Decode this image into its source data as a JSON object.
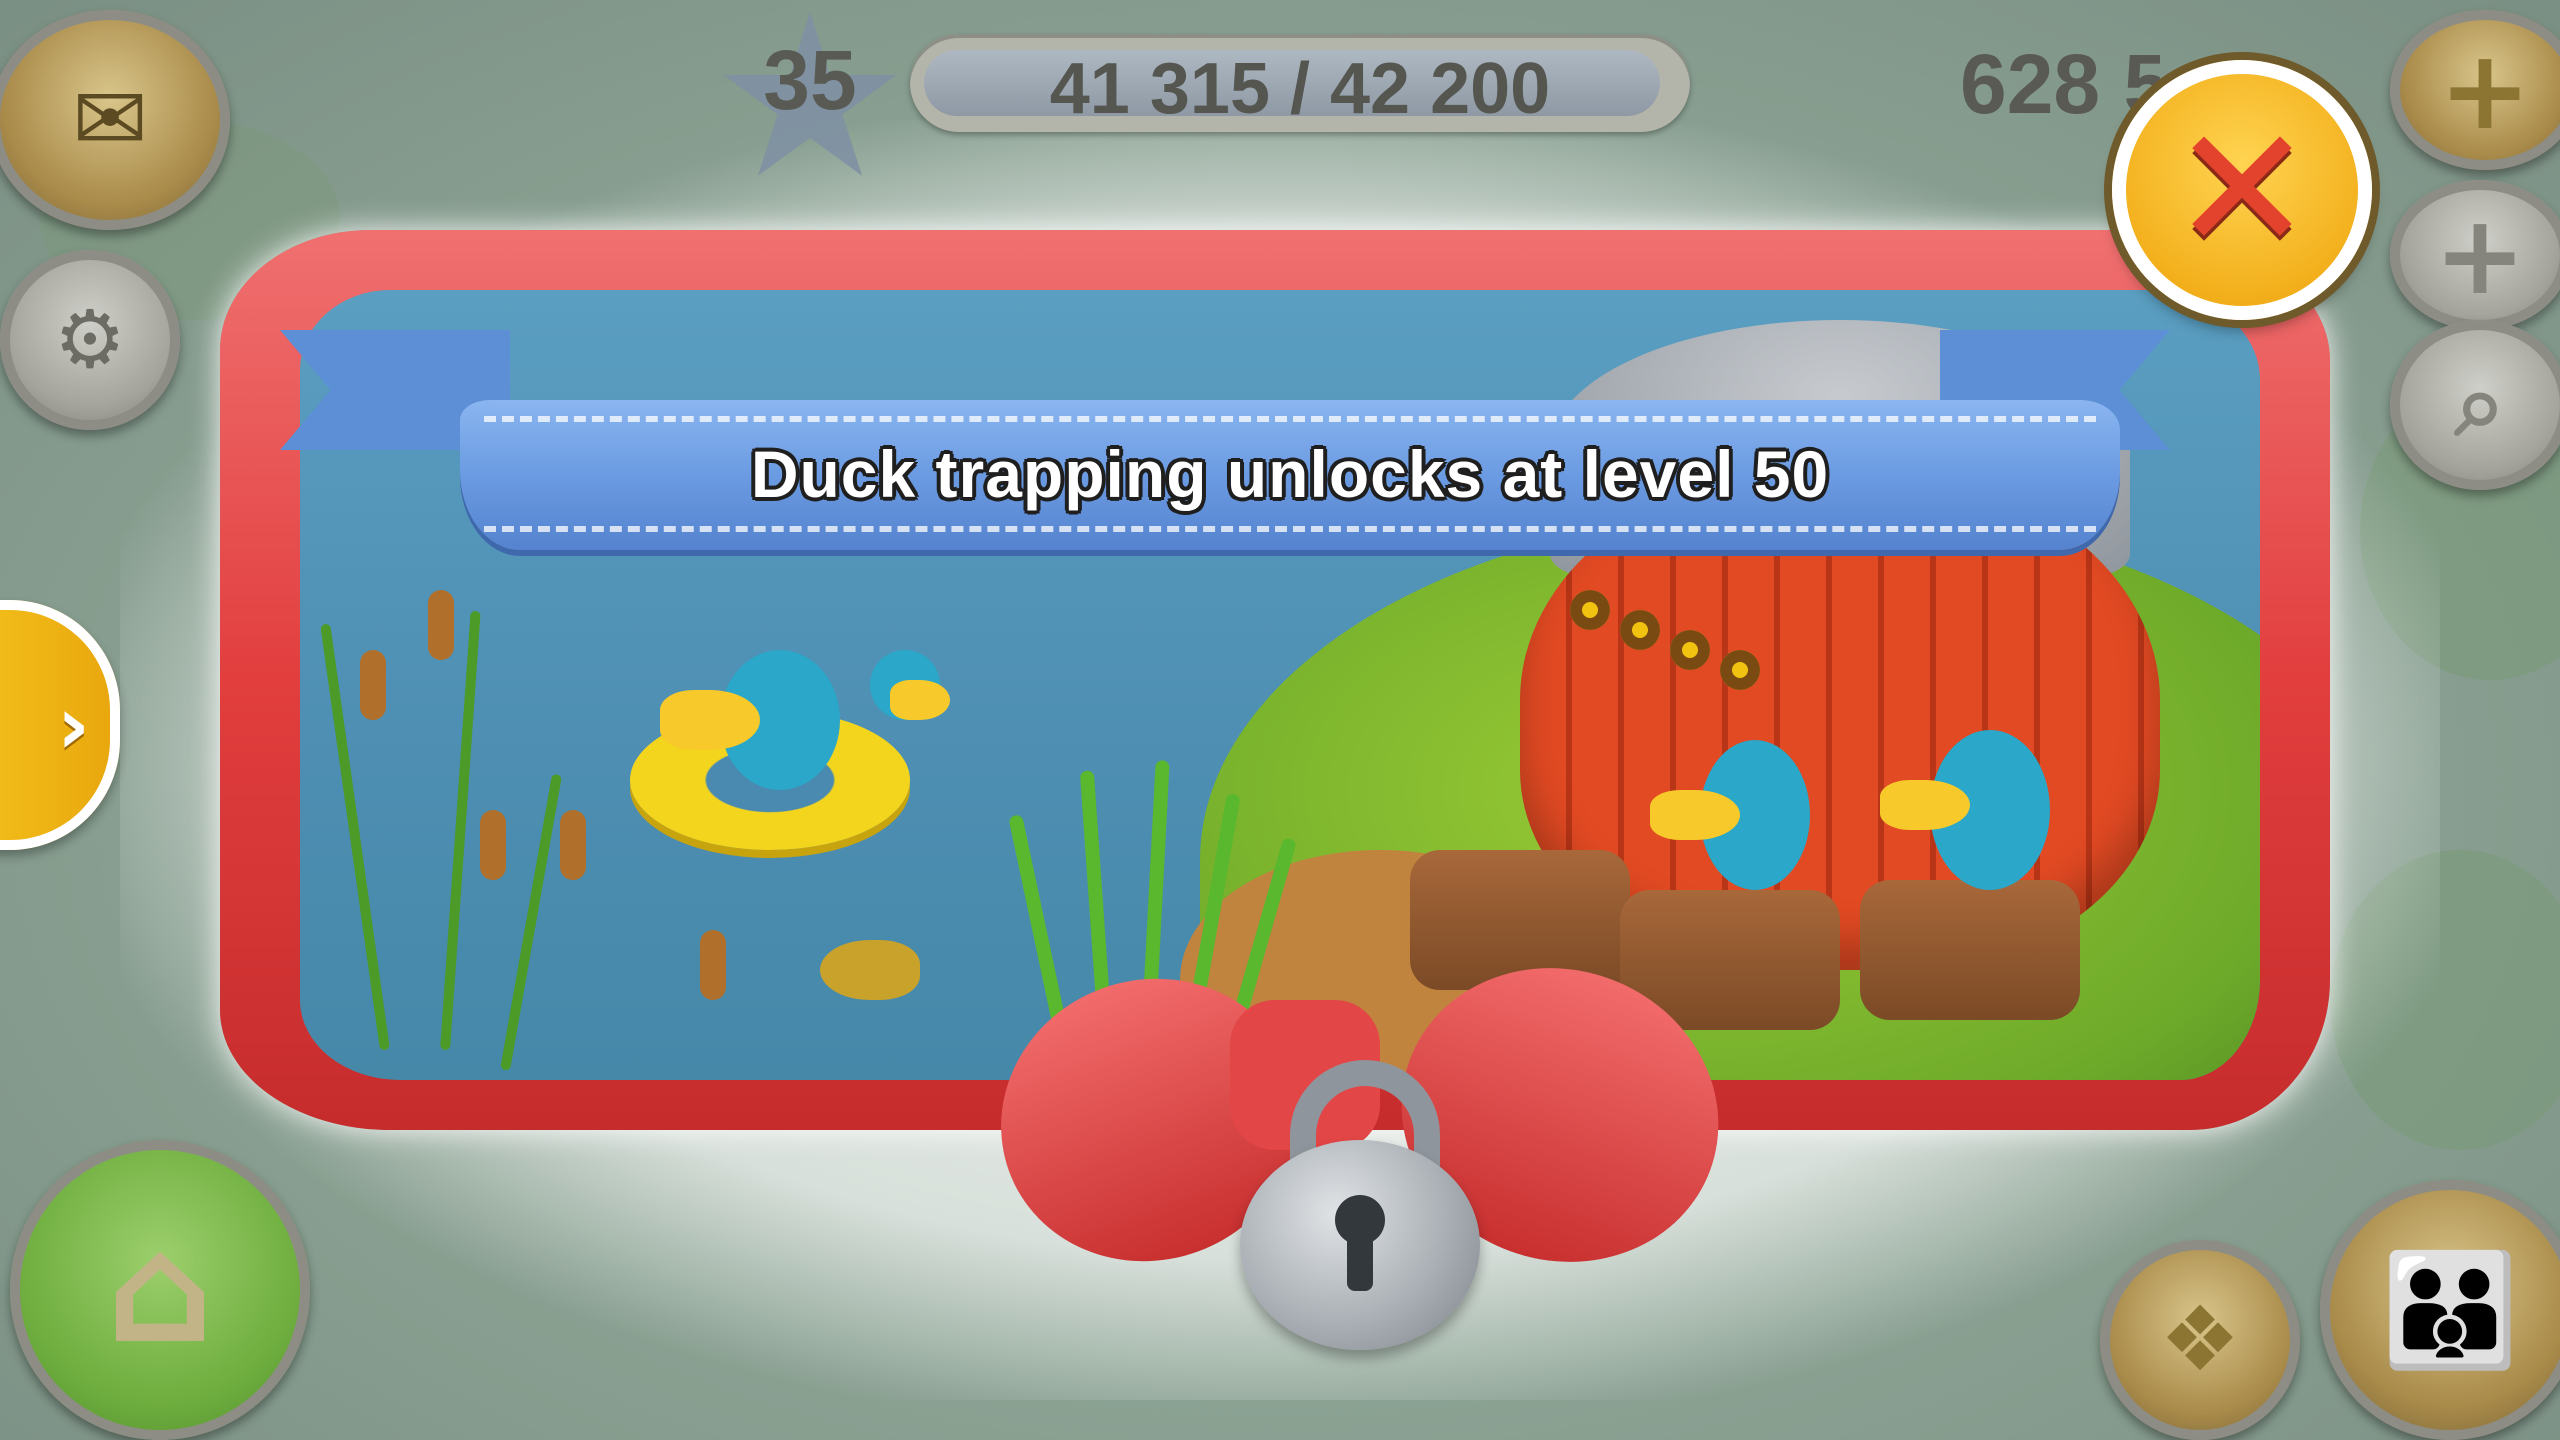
{
  "hud": {
    "level": "35",
    "xp_text": "41 315 / 42 200",
    "xp_progress": 0.979,
    "coins_visible": "628 5"
  },
  "popup": {
    "banner_text": "Duck trapping unlocks at level 50"
  },
  "icons": {
    "mail": "mail-icon",
    "settings": "gear-icon",
    "expand": "chevron-right-icon",
    "home": "home-icon",
    "add_coins": "plus-icon",
    "add_diamonds": "plus-icon",
    "search": "magnifier-icon",
    "friends": "people-icon",
    "cards": "cards-icon",
    "close": "close-icon",
    "lock": "padlock-icon"
  },
  "colors": {
    "ribbon": "#e23e3e",
    "banner": "#6b9be2",
    "close_button": "#f2ad18",
    "close_x": "#e3432c",
    "water": "#4d8eb2",
    "barrel": "#e24a23"
  }
}
